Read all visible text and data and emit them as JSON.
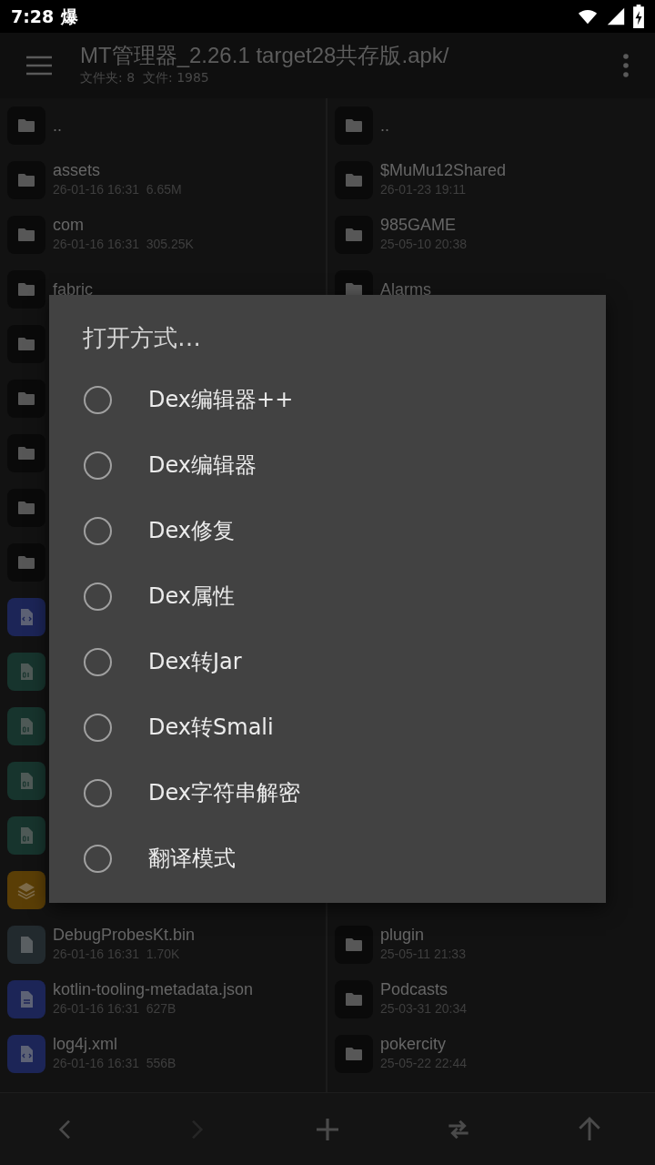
{
  "status_bar": {
    "time": "7:28",
    "notification": "爆"
  },
  "app_bar": {
    "title": "MT管理器_2.26.1 target28共存版.apk/",
    "subtitle": "文件夹: 8  文件: 1985"
  },
  "panes": [
    {
      "top": [
        {
          "kind": "folder",
          "name": ".."
        },
        {
          "kind": "folder",
          "name": "assets",
          "meta": "26-01-16 16:31  6.65M"
        },
        {
          "kind": "folder",
          "name": "com",
          "meta": "26-01-16 16:31  305.25K"
        },
        {
          "kind": "folder",
          "name": "fabric"
        },
        {
          "kind": "folder"
        },
        {
          "kind": "folder"
        },
        {
          "kind": "folder"
        },
        {
          "kind": "folder"
        },
        {
          "kind": "folder"
        },
        {
          "kind": "code"
        },
        {
          "kind": "binary"
        },
        {
          "kind": "binary"
        },
        {
          "kind": "binary"
        },
        {
          "kind": "binary"
        },
        {
          "kind": "layers"
        }
      ],
      "bottom": [
        {
          "kind": "file",
          "name": "DebugProbesKt.bin",
          "meta": "26-01-16 16:31  1.70K"
        },
        {
          "kind": "doc",
          "name": "kotlin-tooling-metadata.json",
          "meta": "26-01-16 16:31  627B"
        },
        {
          "kind": "code",
          "name": "log4j.xml",
          "meta": "26-01-16 16:31  556B"
        }
      ]
    },
    {
      "top": [
        {
          "kind": "folder",
          "name": ".."
        },
        {
          "kind": "folder",
          "name": "$MuMu12Shared",
          "meta": "26-01-23 19:11"
        },
        {
          "kind": "folder",
          "name": "985GAME",
          "meta": "25-05-10 20:38"
        },
        {
          "kind": "folder",
          "name": "Alarms"
        }
      ],
      "bottom": [
        {
          "kind": "folder",
          "name": "plugin",
          "meta": "25-05-11 21:33"
        },
        {
          "kind": "folder",
          "name": "Podcasts",
          "meta": "25-03-31 20:34"
        },
        {
          "kind": "folder",
          "name": "pokercity",
          "meta": "25-05-22 22:44"
        }
      ]
    }
  ],
  "dialog": {
    "title": "打开方式…",
    "options": [
      {
        "label": "Dex编辑器++",
        "selected": false
      },
      {
        "label": "Dex编辑器",
        "selected": false
      },
      {
        "label": "Dex修复",
        "selected": false
      },
      {
        "label": "Dex属性",
        "selected": false
      },
      {
        "label": "Dex转Jar",
        "selected": false
      },
      {
        "label": "Dex转Smali",
        "selected": false
      },
      {
        "label": "Dex字符串解密",
        "selected": false
      },
      {
        "label": "翻译模式",
        "selected": false
      }
    ]
  },
  "toolbar": [
    {
      "kind": "back",
      "disabled": false
    },
    {
      "kind": "forward",
      "disabled": true
    },
    {
      "kind": "add",
      "disabled": false
    },
    {
      "kind": "swap",
      "disabled": false
    },
    {
      "kind": "up",
      "disabled": false
    }
  ]
}
